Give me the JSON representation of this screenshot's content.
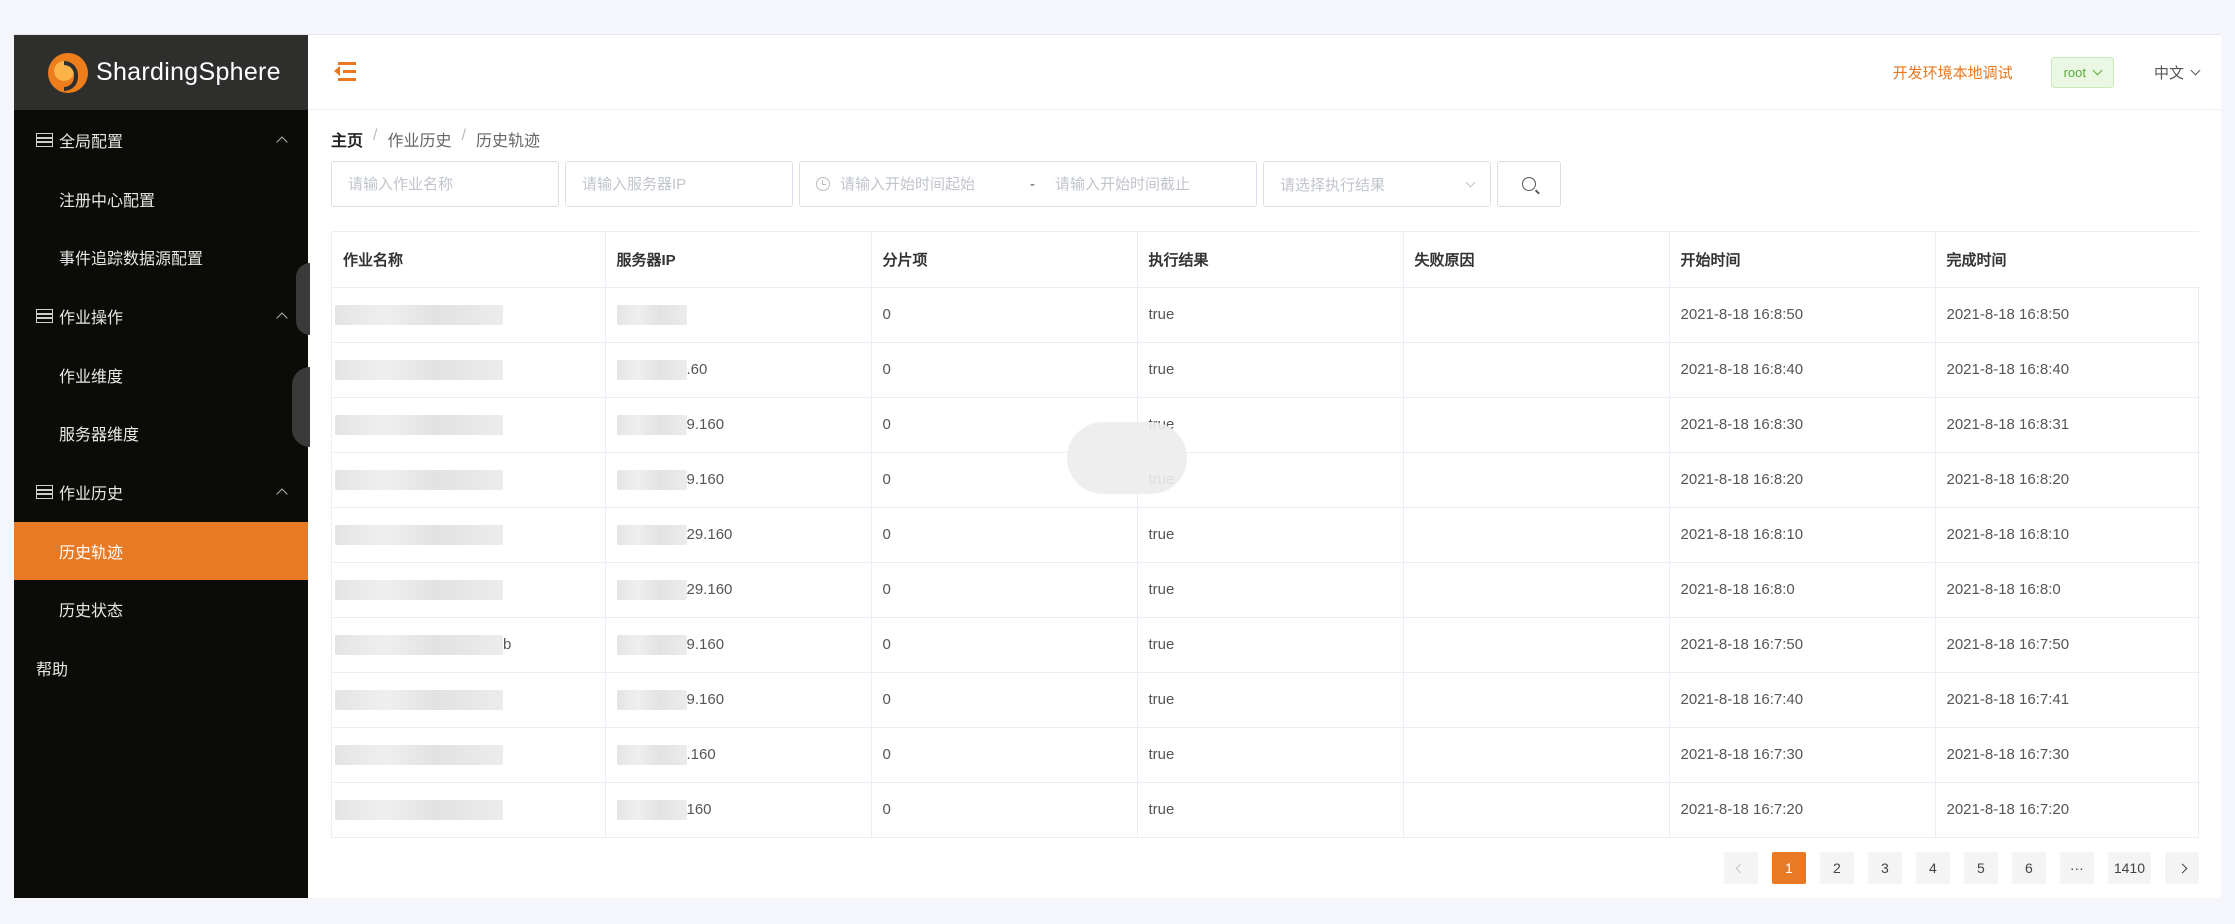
{
  "app": {
    "logo_text": "ShardingSphere"
  },
  "sidebar": {
    "groups": [
      {
        "label": "全局配置",
        "items": [
          "注册中心配置",
          "事件追踪数据源配置"
        ]
      },
      {
        "label": "作业操作",
        "items": [
          "作业维度",
          "服务器维度"
        ]
      },
      {
        "label": "作业历史",
        "items": [
          "历史轨迹",
          "历史状态"
        ]
      }
    ],
    "active_item": "历史轨迹",
    "help": "帮助"
  },
  "header": {
    "env_label": "开发环境本地调试",
    "user": "root",
    "language": "中文"
  },
  "breadcrumb": [
    "主页",
    "作业历史",
    "历史轨迹"
  ],
  "filters": {
    "job_name_placeholder": "请输入作业名称",
    "server_ip_placeholder": "请输入服务器IP",
    "start_from_placeholder": "请输入开始时间起始",
    "range_separator": "-",
    "start_to_placeholder": "请输入开始时间截止",
    "result_placeholder": "请选择执行结果"
  },
  "table": {
    "columns": [
      "作业名称",
      "服务器IP",
      "分片项",
      "执行结果",
      "失败原因",
      "开始时间",
      "完成时间"
    ],
    "rows": [
      {
        "name_tail": "",
        "ip_tail": "",
        "shard": "0",
        "result": "true",
        "failure": "",
        "start": "2021-8-18 16:8:50",
        "end": "2021-8-18 16:8:50"
      },
      {
        "name_tail": "",
        "ip_tail": ".60",
        "shard": "0",
        "result": "true",
        "failure": "",
        "start": "2021-8-18 16:8:40",
        "end": "2021-8-18 16:8:40"
      },
      {
        "name_tail": "",
        "ip_tail": "9.160",
        "shard": "0",
        "result": "true",
        "failure": "",
        "start": "2021-8-18 16:8:30",
        "end": "2021-8-18 16:8:31"
      },
      {
        "name_tail": "",
        "ip_tail": "9.160",
        "shard": "0",
        "result": "true",
        "failure": "",
        "start": "2021-8-18 16:8:20",
        "end": "2021-8-18 16:8:20"
      },
      {
        "name_tail": "",
        "ip_tail": "29.160",
        "shard": "0",
        "result": "true",
        "failure": "",
        "start": "2021-8-18 16:8:10",
        "end": "2021-8-18 16:8:10"
      },
      {
        "name_tail": "",
        "ip_tail": "29.160",
        "shard": "0",
        "result": "true",
        "failure": "",
        "start": "2021-8-18 16:8:0",
        "end": "2021-8-18 16:8:0"
      },
      {
        "name_tail": "b",
        "ip_tail": "9.160",
        "shard": "0",
        "result": "true",
        "failure": "",
        "start": "2021-8-18 16:7:50",
        "end": "2021-8-18 16:7:50"
      },
      {
        "name_tail": "",
        "ip_tail": "9.160",
        "shard": "0",
        "result": "true",
        "failure": "",
        "start": "2021-8-18 16:7:40",
        "end": "2021-8-18 16:7:41"
      },
      {
        "name_tail": "",
        "ip_tail": ".160",
        "shard": "0",
        "result": "true",
        "failure": "",
        "start": "2021-8-18 16:7:30",
        "end": "2021-8-18 16:7:30"
      },
      {
        "name_tail": "",
        "ip_tail": "160",
        "shard": "0",
        "result": "true",
        "failure": "",
        "start": "2021-8-18 16:7:20",
        "end": "2021-8-18 16:7:20"
      }
    ]
  },
  "pagination": {
    "pages": [
      "1",
      "2",
      "3",
      "4",
      "5",
      "6",
      "···",
      "1410"
    ],
    "current": "1"
  },
  "colors": {
    "accent": "#e87a26",
    "sidebar_bg": "#0b0b07",
    "logo_bar_bg": "#2e2e2c",
    "user_badge_text": "#5aa838"
  }
}
